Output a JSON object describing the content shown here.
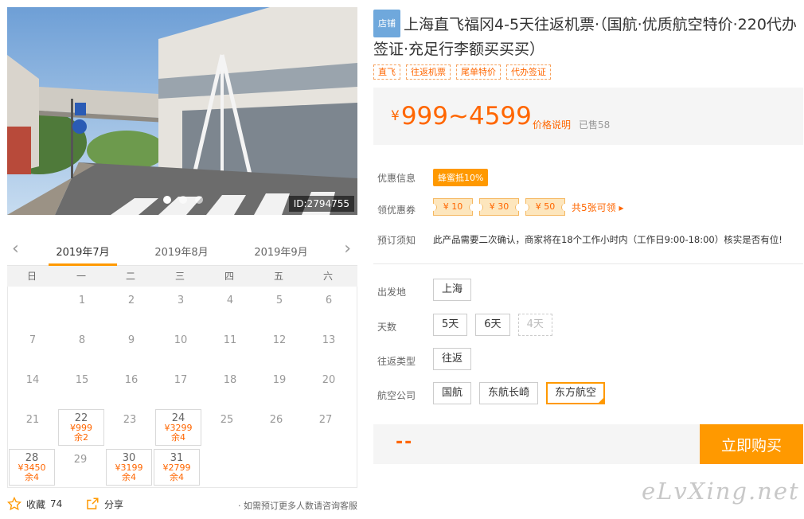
{
  "photo": {
    "id_label": "ID:2794755"
  },
  "calendar": {
    "months": [
      "2019年7月",
      "2019年8月",
      "2019年9月"
    ],
    "weekdays": [
      "日",
      "一",
      "二",
      "三",
      "四",
      "五",
      "六"
    ],
    "rows": [
      [
        {
          "d": ""
        },
        {
          "d": "1"
        },
        {
          "d": "2"
        },
        {
          "d": "3"
        },
        {
          "d": "4"
        },
        {
          "d": "5"
        },
        {
          "d": "6"
        }
      ],
      [
        {
          "d": "7"
        },
        {
          "d": "8"
        },
        {
          "d": "9"
        },
        {
          "d": "10"
        },
        {
          "d": "11"
        },
        {
          "d": "12"
        },
        {
          "d": "13"
        }
      ],
      [
        {
          "d": "14"
        },
        {
          "d": "15"
        },
        {
          "d": "16"
        },
        {
          "d": "17"
        },
        {
          "d": "18"
        },
        {
          "d": "19"
        },
        {
          "d": "20"
        }
      ],
      [
        {
          "d": "21"
        },
        {
          "d": "22",
          "p": "¥999",
          "r": "余2"
        },
        {
          "d": "23"
        },
        {
          "d": "24",
          "p": "¥3299",
          "r": "余4"
        },
        {
          "d": "25"
        },
        {
          "d": "26"
        },
        {
          "d": "27"
        }
      ],
      [
        {
          "d": "28",
          "p": "¥3450",
          "r": "余4"
        },
        {
          "d": "29"
        },
        {
          "d": "30",
          "p": "¥3199",
          "r": "余4"
        },
        {
          "d": "31",
          "p": "¥2799",
          "r": "余4"
        },
        {
          "d": ""
        },
        {
          "d": ""
        },
        {
          "d": ""
        }
      ]
    ]
  },
  "footer": {
    "favorite_label": "收藏",
    "favorite_count": "74",
    "share_label": "分享",
    "note": "· 如需预订更多人数请咨询客服"
  },
  "product": {
    "shop_tag": "店铺",
    "title": "上海直飞福冈4-5天往返机票·（国航·优质航空特价·220代办签证·充足行李额买买买）",
    "tags": [
      "直飞",
      "往返机票",
      "尾单特价",
      "代办签证"
    ],
    "price_currency": "¥",
    "price": "999~4599",
    "price_explain": "价格说明",
    "sold": "已售58"
  },
  "info": {
    "discount_label": "优惠信息",
    "discount_value": "蜂蜜抵10%",
    "coupon_label": "领优惠券",
    "coupons": [
      "¥ 10",
      "¥ 30",
      "¥ 50"
    ],
    "coupon_more": "共5张可领 ▸",
    "booking_label": "预订须知",
    "booking_note": "此产品需要二次确认，商家将在18个工作小时内（工作日9:00-18:00）核实是否有位!"
  },
  "options": {
    "departure_label": "出发地",
    "departure": [
      "上海"
    ],
    "days_label": "天数",
    "days": [
      "5天",
      "6天",
      "4天"
    ],
    "trip_label": "往返类型",
    "trip": [
      "往返"
    ],
    "airline_label": "航空公司",
    "airline": [
      "国航",
      "东航长崎",
      "东方航空"
    ]
  },
  "buy": {
    "total": "--",
    "button_label": "立即购买"
  },
  "watermark": "eLvXing.net",
  "colors": {
    "accent": "#ff9900",
    "price": "#ff6600",
    "shop_tag": "#6fa8dc"
  }
}
